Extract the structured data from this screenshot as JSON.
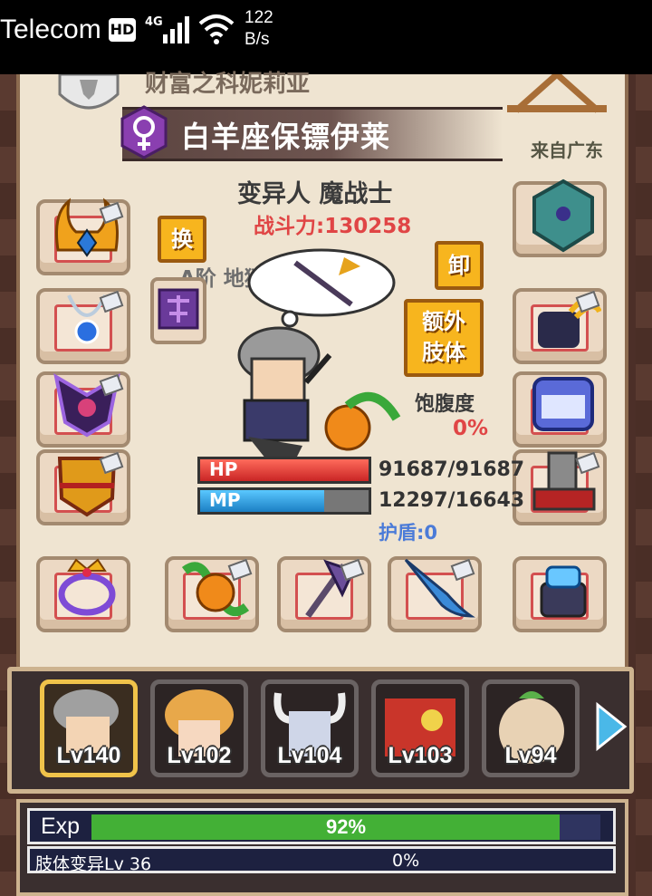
{
  "status_bar": {
    "carrier": "Telecom",
    "hd_badge": "HD",
    "network_type": "4G",
    "speed_value": "122",
    "speed_unit": "B/s"
  },
  "header": {
    "top_name": "财富之科妮莉亚",
    "character_name": "白羊座保镖伊莱",
    "origin": "来自广东",
    "race_class": "变异人 魔战士",
    "combat_power": "战斗力:130258",
    "tier_line": "A阶 地狱使者 Lv 74"
  },
  "buttons": {
    "swap": "换",
    "unequip": "卸",
    "extra_limb_line1": "额外",
    "extra_limb_line2": "肢体"
  },
  "stats": {
    "hunger_label": "饱腹度",
    "hunger_value": "0%",
    "hp_label": "HP",
    "hp_value": "91687/91687",
    "hp_fraction": 1.0,
    "mp_label": "MP",
    "mp_value": "12297/16643",
    "mp_fraction": 0.739,
    "shield": "护盾:0"
  },
  "equipment": {
    "left": [
      "horned-helmet",
      "blue-gem-necklace",
      "dark-winged-armor",
      "golden-chest-armor",
      "crown-ring"
    ],
    "right": [
      "emblem-shield",
      "claw-gloves",
      "supply-box",
      "cannon-boots",
      "crystal-device"
    ],
    "bottom": [
      "pumpkin-plant",
      "purple-axe",
      "swordfish-weapon"
    ]
  },
  "party": [
    {
      "level": "Lv140",
      "active": true
    },
    {
      "level": "Lv102",
      "active": false
    },
    {
      "level": "Lv104",
      "active": false
    },
    {
      "level": "Lv103",
      "active": false
    },
    {
      "level": "Lv94",
      "active": false
    }
  ],
  "exp": {
    "label": "Exp",
    "value": "92%",
    "fraction": 0.92
  },
  "limb": {
    "label": "肢体变异Lv 36",
    "value": "0%"
  }
}
